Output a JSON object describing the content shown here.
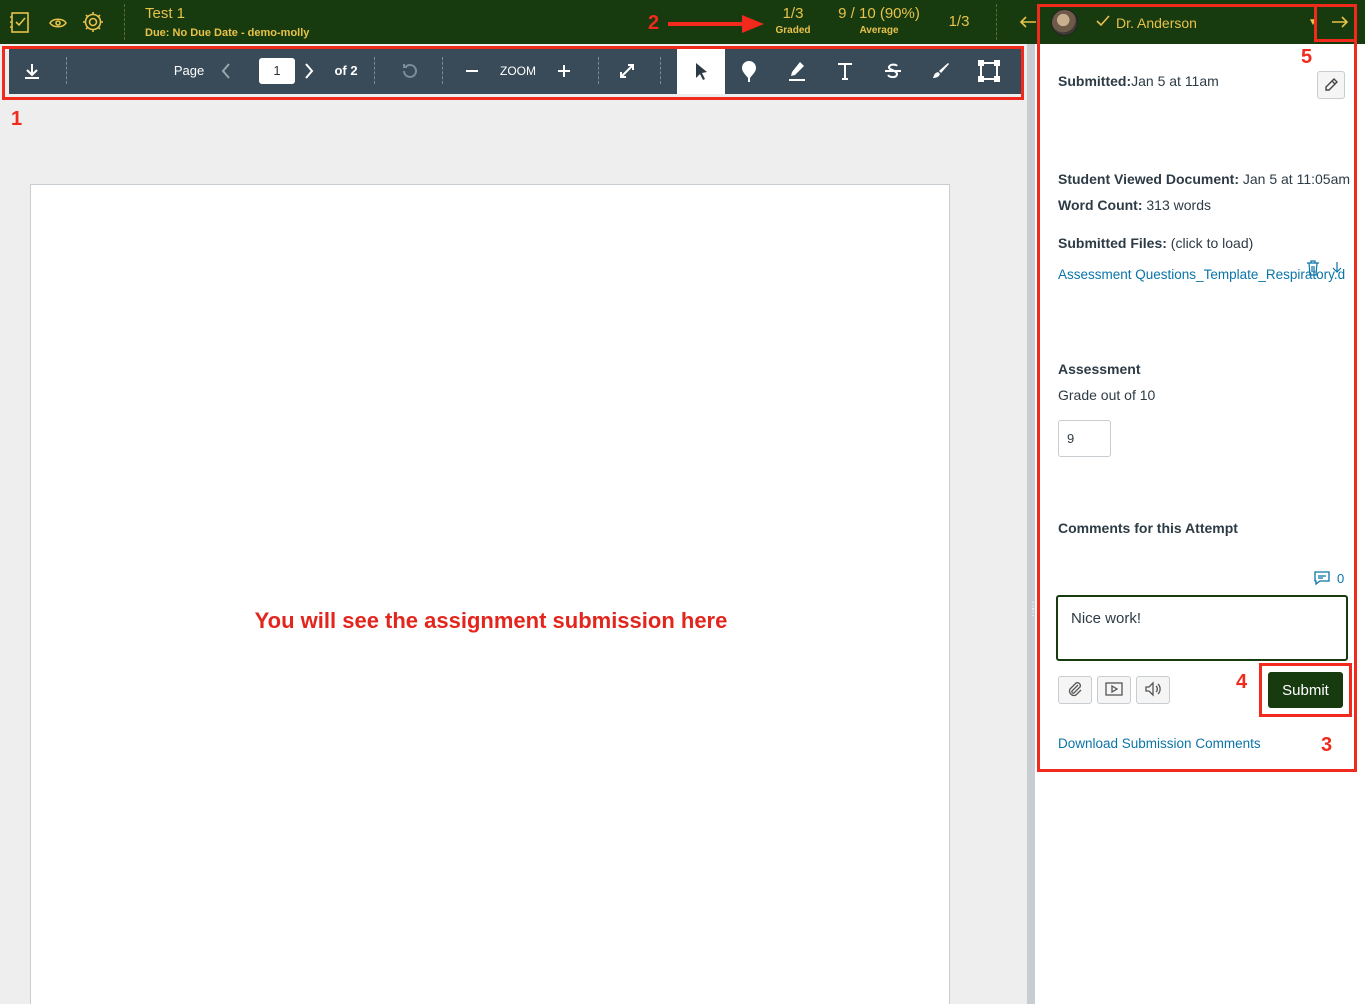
{
  "header": {
    "assignment_title": "Test 1",
    "assignment_subtitle": "Due: No Due Date - demo-molly",
    "graded_count": "1/3",
    "graded_label": "Graded",
    "average_value": "9 / 10 (90%)",
    "average_label": "Average",
    "student_position": "1/3",
    "student_name": "Dr. Anderson",
    "icons": [
      "gradebook-icon",
      "eye-icon",
      "gear-icon",
      "arrow-left-icon",
      "arrow-right-icon",
      "checkmark-icon",
      "chevron-down-icon"
    ]
  },
  "toolbar": {
    "page_label": "Page",
    "page_value": "1",
    "page_of": "of 2",
    "zoom_label": "ZOOM",
    "tools": [
      "download-icon",
      "prev-page-icon",
      "next-page-icon",
      "rotate-icon",
      "zoom-out-icon",
      "zoom-in-icon",
      "fullscreen-icon",
      "pointer-icon",
      "point-annotation-icon",
      "highlight-icon",
      "text-icon",
      "strikeout-icon",
      "freedraw-icon",
      "area-icon"
    ],
    "active_tool": "pointer-icon"
  },
  "document": {
    "placeholder": "You will see the assignment submission here"
  },
  "panel": {
    "submitted_label": "Submitted:",
    "submitted_value": "Jan 5 at 11am",
    "viewed_label": "Student Viewed Document:",
    "viewed_value": " Jan 5 at 11:05am",
    "word_count_label": "Word Count:",
    "word_count_value": " 313 words",
    "files_label": "Submitted Files:",
    "files_hint": " (click to load)",
    "file_name": "Assessment Questions_Template_Respiratory.d",
    "assessment_heading": "Assessment",
    "grade_out_of": "Grade out of 10",
    "grade_value": "9",
    "comments_heading": "Comments for this Attempt",
    "comment_count": "0",
    "comment_text": "Nice work!",
    "submit_label": "Submit",
    "download_comments": "Download Submission Comments"
  },
  "annotations": [
    "1",
    "2",
    "3",
    "4",
    "5"
  ],
  "colors": {
    "header_bg": "#173a0f",
    "header_text": "#e8c24a",
    "toolbar_bg": "#394b58",
    "annotation_red": "#f02a1d",
    "link": "#0b74a8"
  }
}
